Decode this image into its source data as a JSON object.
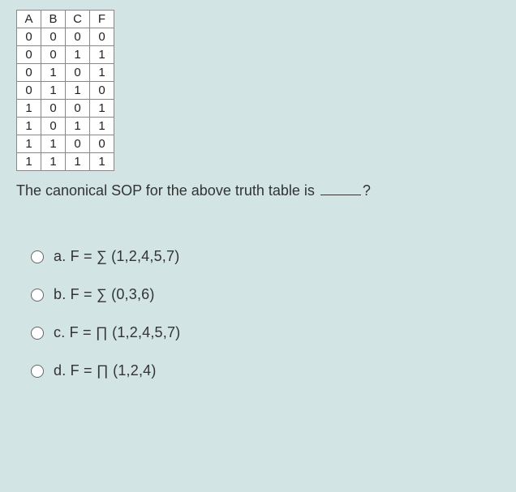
{
  "chart_data": {
    "type": "table",
    "headers": [
      "A",
      "B",
      "C",
      "F"
    ],
    "rows": [
      [
        "0",
        "0",
        "0",
        "0"
      ],
      [
        "0",
        "0",
        "1",
        "1"
      ],
      [
        "0",
        "1",
        "0",
        "1"
      ],
      [
        "0",
        "1",
        "1",
        "0"
      ],
      [
        "1",
        "0",
        "0",
        "1"
      ],
      [
        "1",
        "0",
        "1",
        "1"
      ],
      [
        "1",
        "1",
        "0",
        "0"
      ],
      [
        "1",
        "1",
        "1",
        "1"
      ]
    ]
  },
  "question": {
    "prefix": "The canonical SOP for the above truth table is ",
    "suffix": "?"
  },
  "options": [
    {
      "label": "a. F = ∑ (1,2,4,5,7)"
    },
    {
      "label": "b. F = ∑ (0,3,6)"
    },
    {
      "label": "c. F = ∏ (1,2,4,5,7)"
    },
    {
      "label": "d. F = ∏ (1,2,4)"
    }
  ]
}
